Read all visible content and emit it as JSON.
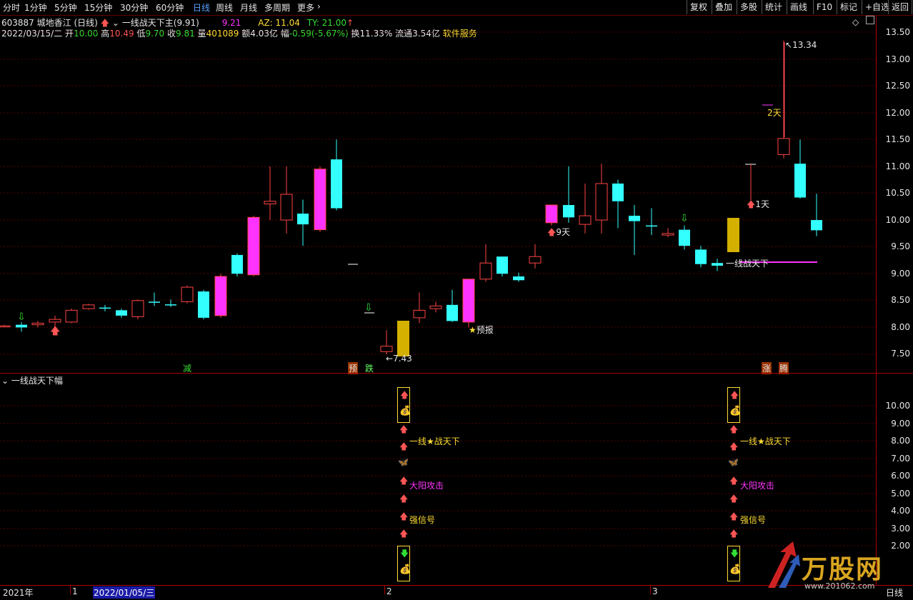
{
  "toolbar": {
    "periods": [
      "分时",
      "1分钟",
      "5分钟",
      "15分钟",
      "30分钟",
      "60分钟",
      "日线",
      "周线",
      "月线",
      "多周期",
      "更多"
    ],
    "active_period": "日线",
    "right_buttons": [
      "复权",
      "叠加",
      "多股",
      "统计",
      "画线",
      "F10",
      "标记",
      "+自选",
      "返回"
    ]
  },
  "stock": {
    "code": "603887",
    "name": "城地香江",
    "cycle": "(日线)",
    "indicator_name": "一线战天下主",
    "indicator_value": "(9.91)",
    "extra_value": "9.21",
    "az": "AZ: 11.04",
    "ty": "TY: 21.00"
  },
  "quote": {
    "date": "2022/03/15/二",
    "open_label": "开",
    "open": "10.00",
    "high_label": "高",
    "high": "10.49",
    "low_label": "低",
    "low": "9.70",
    "close_label": "收",
    "close": "9.81",
    "vol_label": "量",
    "vol": "401089",
    "amount_label": "额",
    "amount": "4.03亿",
    "chg_label": "幅",
    "chg": "-0.59(-5.67%)",
    "turnover": "换11.33%",
    "float": "流通3.54亿",
    "industry": "软件服务"
  },
  "main_axis": [
    "13.50",
    "13.00",
    "12.50",
    "12.00",
    "11.50",
    "11.00",
    "10.50",
    "10.00",
    "9.50",
    "9.00",
    "8.50",
    "8.00",
    "7.50"
  ],
  "sub_panel": {
    "title": "一线战天下幅",
    "axis": [
      "10.00",
      "9.00",
      "8.00",
      "7.00",
      "6.00",
      "5.00",
      "4.00",
      "3.00",
      "2.00"
    ],
    "sig1": "一线★战天下",
    "sig2": "大阳攻击",
    "sig3": "强信号"
  },
  "annotations": {
    "high_price": "13.34",
    "low_price": "7.43",
    "two_days": "2天",
    "one_day": "1天",
    "nine_days": "9天",
    "warning": "预报",
    "yixian": "一线战天下",
    "tag_jian": "减",
    "tag_yu": "预",
    "tag_die": "跌",
    "tag_zhang": "涨",
    "tag_teng": "腾"
  },
  "xaxis": {
    "year": "2021年",
    "m1": "1",
    "date_box": "2022/01/05/三",
    "m2": "2",
    "m3": "3",
    "right_label": "日线"
  },
  "watermark": {
    "brand": "万股网",
    "url": "www.201062.com"
  },
  "colors": {
    "up": "#ff4444",
    "down": "#33ffff",
    "magenta": "#ff33ff",
    "gold": "#ffdd33"
  }
}
